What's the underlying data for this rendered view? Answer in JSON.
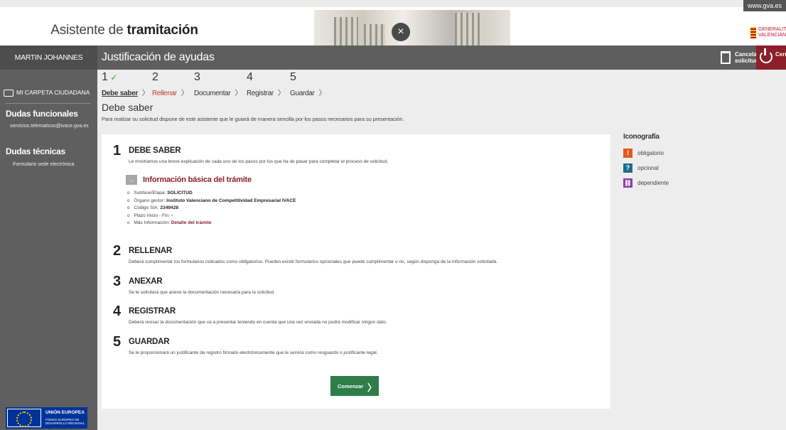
{
  "header": {
    "title_light": "Asistente de",
    "title_bold": "tramitación",
    "gva_top": "www.gva.es",
    "gva_logo_text": "GENERALITAT VALENCIANA"
  },
  "bar": {
    "user_name": "MARTIN JOHANNES VORBECK",
    "page_heading": "Justificación de ayudas",
    "cancel_label": "Cancela solicitud",
    "close_label": "Cerrar Aplicación"
  },
  "sidebar": {
    "folder_link": "MI CARPETA CIUDADANA",
    "functional_title": "Dudas funcionales",
    "functional_email": "servicios.telematicos@ivace.gva.es",
    "technical_title": "Dudas técnicas",
    "technical_link": "Formulario sede electrónica",
    "eu_title": "UNIÓN EUROPEA",
    "eu_subtitle": "FONDO EUROPEO DE DESARROLLO REGIONAL"
  },
  "steps": [
    {
      "num": "1",
      "name": "Debe saber",
      "check": "✓"
    },
    {
      "num": "2",
      "name": "Rellenar",
      "check": ""
    },
    {
      "num": "3",
      "name": "Documentar",
      "check": ""
    },
    {
      "num": "4",
      "name": "Registrar",
      "check": ""
    },
    {
      "num": "5",
      "name": "Guardar",
      "check": ""
    }
  ],
  "section": {
    "title": "Debe saber",
    "description": "Para realizar su solicitud dispone de este asistente que le guiará de manera sencilla por los pasos necesarios para su presentación."
  },
  "items": [
    {
      "num": "1",
      "head": "DEBE SABER",
      "desc": "Le mostramos una breve explicación de cada uno de los pasos por los que ha de pasar para completar el proceso de solicitud."
    },
    {
      "num": "2",
      "head": "RELLENAR",
      "desc": "Deberá cumplimentar los formularios indicados como obligatorios. Pueden existir formularios opcionales que puede cumplimentar o no, según disponga de la información solicitada."
    },
    {
      "num": "3",
      "head": "ANEXAR",
      "desc": "Se le solicitará que anexe la documentación necesaria para la solicitud."
    },
    {
      "num": "4",
      "head": "REGISTRAR",
      "desc": "Deberá revisar la documentación que va a presentar teniendo en cuenta que una vez enviada no podrá modificar ningún dato."
    },
    {
      "num": "5",
      "head": "GUARDAR",
      "desc": "Se le proporcionará un justificante de registro firmado electrónicamente que le servirá como resguardo o justificante legal."
    }
  ],
  "info": {
    "toggle_label": "Información básica del trámite",
    "rows": [
      {
        "label": "Subfase/Etapa:",
        "value": "SOLICITUD"
      },
      {
        "label": "Órgano gestor:",
        "value": "Instituto Valenciano de Competitividad Empresarial IVACE"
      },
      {
        "label": "Código SIA:",
        "value": "2349428"
      },
      {
        "label": "Plazo Inicio - Fin:",
        "value": "-"
      }
    ],
    "more_label": "Más Información:",
    "more_link": "Detalle del trámite"
  },
  "start_button": "Comenzar",
  "iconografia": {
    "title": "Iconografía",
    "items": [
      {
        "icon": "exclamation-icon",
        "glyph": "!",
        "color": "#e05a1c",
        "label": "obligatorio"
      },
      {
        "icon": "question-icon",
        "glyph": "?",
        "color": "#1c6e8c",
        "label": "opcional"
      },
      {
        "icon": "link-icon",
        "glyph": "⛓",
        "color": "#8e3fa8",
        "label": "dependiente"
      }
    ]
  }
}
